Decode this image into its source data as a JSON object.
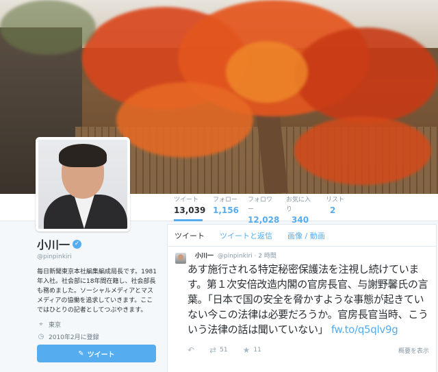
{
  "stats": [
    {
      "label": "ツイート",
      "value": "13,039"
    },
    {
      "label": "フォロー",
      "value": "1,156"
    },
    {
      "label": "フォロワー",
      "value": "12,028"
    },
    {
      "label": "お気に入り",
      "value": "340"
    },
    {
      "label": "リスト",
      "value": "2"
    }
  ],
  "profile": {
    "name": "小川一",
    "handle": "@pinpinkiri",
    "bio": "毎日新聞東京本社編集編成局長です。1981年入社。社会部に18年間在籍し、社会部長も務めました。ソーシャルメディアとマスメディアの協働を追求していきます。ここではひとりの記者としてつぶやきます。",
    "location": "東京",
    "joined": "2010年2月に登録",
    "tweet_button": "ツイート"
  },
  "icons": {
    "verified": "verified-badge-icon",
    "location": "map-pin-icon",
    "joined": "calendar-icon",
    "compose": "compose-icon",
    "reply": "reply-icon",
    "retweet": "retweet-icon",
    "favorite": "star-icon"
  },
  "timeline": {
    "tabs": [
      "ツイート",
      "ツイートと返信",
      "画像 / 動画"
    ],
    "tweet": {
      "name": "小川一",
      "handle": "@pinpinkiri",
      "time": "2 時間",
      "text": "あす施行される特定秘密保護法を注視し続けています。第１次安倍改造内閣の官房長官、与謝野馨氏の言葉。「日本で国の安全を脅かすような事態が起きていない今この法律は必要だろうか。官房長官当時、こういう法律の話は聞いていない」",
      "link": "fw.to/q5qlv9g",
      "retweets": "51",
      "favorites": "11",
      "expand": "概要を表示"
    }
  },
  "colors": {
    "accent": "#55acee",
    "text": "#292f33",
    "muted": "#8899a6"
  }
}
